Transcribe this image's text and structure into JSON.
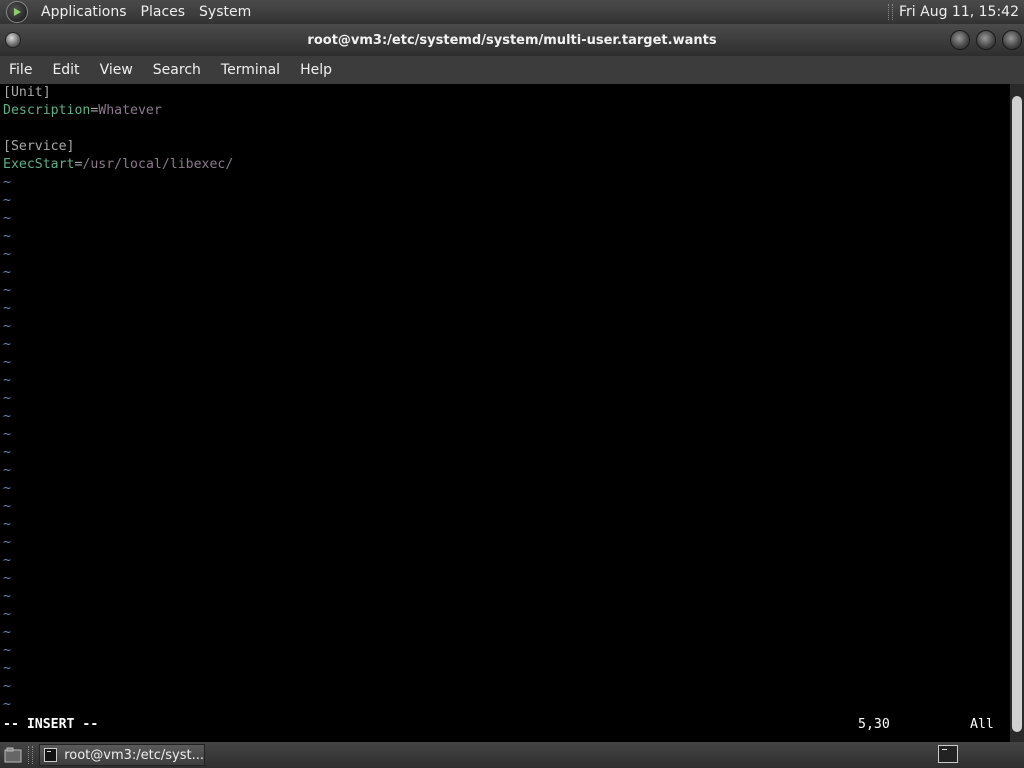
{
  "top_panel": {
    "menus": [
      "Applications",
      "Places",
      "System"
    ],
    "clock": "Fri Aug 11, 15:42"
  },
  "window": {
    "title": "root@vm3:/etc/systemd/system/multi-user.target.wants"
  },
  "menubar": {
    "items": [
      "File",
      "Edit",
      "View",
      "Search",
      "Terminal",
      "Help"
    ]
  },
  "terminal": {
    "lines": [
      {
        "section": "[Unit]"
      },
      {
        "key": "Description",
        "eq": "=",
        "value": "Whatever"
      },
      {
        "blank": ""
      },
      {
        "section": "[Service]"
      },
      {
        "key": "ExecStart",
        "eq": "=",
        "value": "/usr/local/libexec/"
      }
    ],
    "tilde": "~",
    "status": {
      "mode": "-- INSERT --",
      "position": "5,30",
      "scroll": "All"
    }
  },
  "taskbar": {
    "task_label": "root@vm3:/etc/syst..."
  },
  "colors": {
    "key": "#5faf87",
    "value": "#8a7a8c",
    "tilde": "#5f87af"
  }
}
